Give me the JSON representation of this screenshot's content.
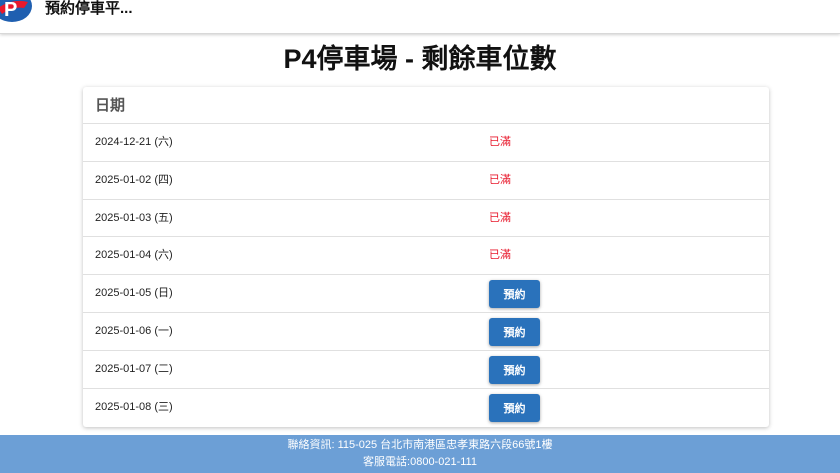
{
  "app": {
    "name": "預約停車平..."
  },
  "colors": {
    "brand_blue": "#2a72bb",
    "brand_red": "#e8192c",
    "footer_bg": "#6c9fd6"
  },
  "page": {
    "title": "P4停車場 - 剩餘車位數"
  },
  "table": {
    "header": "日期",
    "rows": [
      {
        "date": "2024-12-21 (六)",
        "status": "已滿"
      },
      {
        "date": "2025-01-02 (四)",
        "status": "已滿"
      },
      {
        "date": "2025-01-03 (五)",
        "status": "已滿"
      },
      {
        "date": "2025-01-04 (六)",
        "status": "已滿"
      },
      {
        "date": "2025-01-05 (日)",
        "button": "預約"
      },
      {
        "date": "2025-01-06 (一)",
        "button": "預約"
      },
      {
        "date": "2025-01-07 (二)",
        "button": "預約"
      },
      {
        "date": "2025-01-08 (三)",
        "button": "預約"
      }
    ]
  },
  "footer": {
    "contact": "聯絡資訊: 115-025 台北市南港區忠孝東路六段66號1樓",
    "phone": "客服電話:0800-021-111"
  }
}
